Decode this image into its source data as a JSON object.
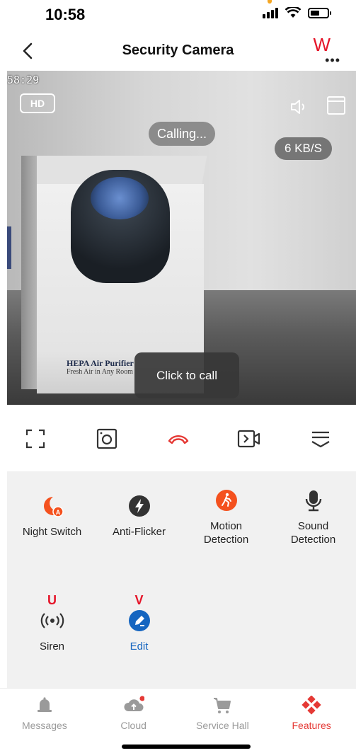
{
  "status": {
    "time": "10:58"
  },
  "header": {
    "title": "Security Camera",
    "more_marker": "W"
  },
  "video": {
    "timestamp": "58:29",
    "quality_badge": "HD",
    "calling_text": "Calling...",
    "speed_text": "6 KB/S",
    "call_button": "Click to call",
    "product_text_1": "HEPA Air Purifier",
    "product_text_2": "Fresh Air in Any Room"
  },
  "toolbar": {
    "items": [
      {
        "icon": "fullscreen-icon"
      },
      {
        "icon": "snapshot-icon"
      },
      {
        "icon": "hang-up-icon"
      },
      {
        "icon": "record-icon"
      },
      {
        "icon": "collapse-icon"
      }
    ]
  },
  "features": {
    "items": [
      {
        "label": "Night Switch",
        "icon": "night-switch-icon",
        "color": "#f4511e"
      },
      {
        "label": "Anti-Flicker",
        "icon": "anti-flicker-icon",
        "color": "#333333"
      },
      {
        "label": "Motion\nDetection",
        "icon": "motion-detection-icon",
        "color": "#f4511e"
      },
      {
        "label": "Sound\nDetection",
        "icon": "sound-detection-icon",
        "color": "#333333"
      },
      {
        "label": "Siren",
        "icon": "siren-icon",
        "marker": "U",
        "color": "#333333"
      },
      {
        "label": "Edit",
        "icon": "edit-icon",
        "marker": "V",
        "color": "#1565c0"
      }
    ]
  },
  "bottom_nav": {
    "items": [
      {
        "label": "Messages",
        "icon": "bell-icon"
      },
      {
        "label": "Cloud",
        "icon": "cloud-icon"
      },
      {
        "label": "Service Hall",
        "icon": "cart-icon"
      },
      {
        "label": "Features",
        "icon": "features-icon",
        "active": true
      }
    ],
    "active_color": "#e53935",
    "inactive_color": "#9a9a9a"
  }
}
